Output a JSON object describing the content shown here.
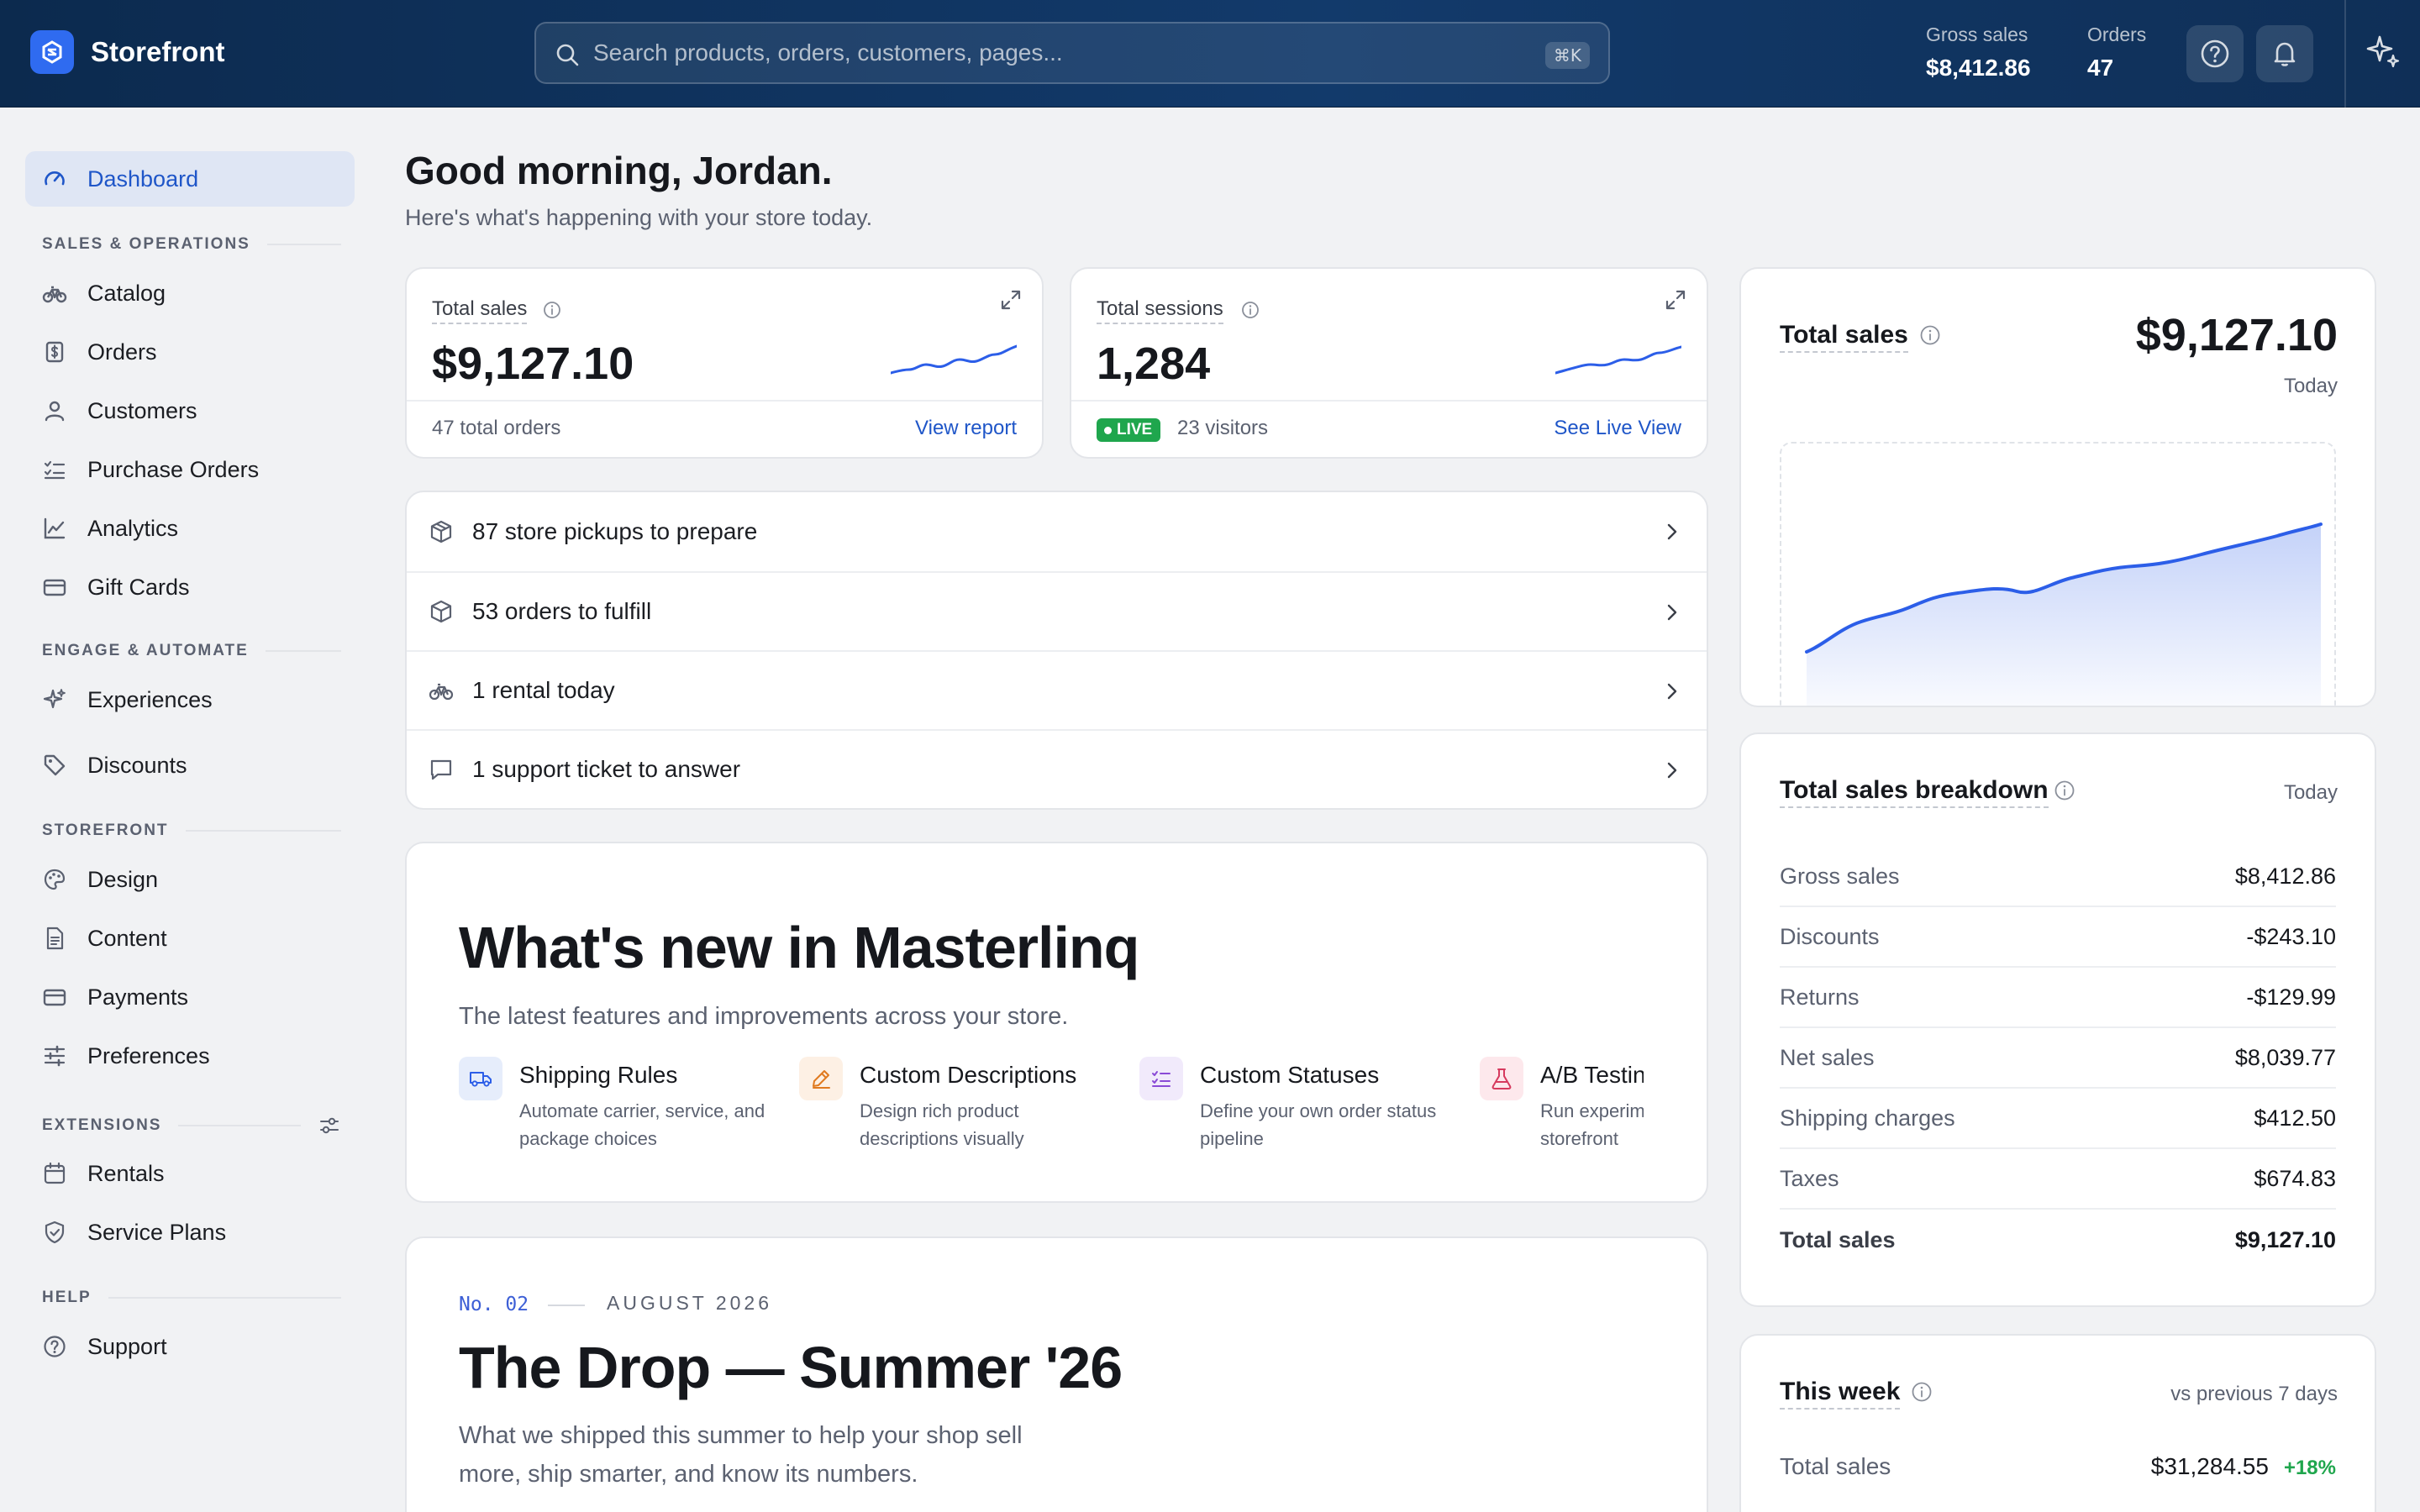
{
  "app": {
    "name": "Storefront"
  },
  "search": {
    "placeholder": "Search products, orders, customers, pages...",
    "shortcut": "⌘K"
  },
  "header_stats": [
    {
      "label": "Gross sales",
      "value": "$8,412.86"
    },
    {
      "label": "Orders",
      "value": "47"
    }
  ],
  "sidebar": {
    "dashboard": "Dashboard",
    "sections": [
      "SALES & OPERATIONS",
      "ENGAGE & AUTOMATE",
      "STOREFRONT",
      "EXTENSIONS",
      "HELP"
    ],
    "items": [
      "Catalog",
      "Orders",
      "Customers",
      "Purchase Orders",
      "Analytics",
      "Gift Cards",
      "Experiences",
      "Discounts",
      "Design",
      "Content",
      "Payments",
      "Preferences",
      "Rentals",
      "Service Plans",
      "Support"
    ]
  },
  "greeting": {
    "title": "Good morning, Jordan.",
    "subtitle": "Here's what's happening with your store today."
  },
  "kpi_sales": {
    "title": "Total sales",
    "value": "$9,127.10",
    "footer": "47 total orders",
    "link": "View report"
  },
  "kpi_sessions": {
    "title": "Total sessions",
    "value": "1,284",
    "badge": "LIVE",
    "footer": "23 visitors",
    "link": "See Live View"
  },
  "tasks": [
    "87 store pickups to prepare",
    "53 orders to fulfill",
    "1 rental today",
    "1 support ticket to answer"
  ],
  "whats_new": {
    "title": "What's new in Masterlinq",
    "subtitle": "The latest features and improvements across your store.",
    "features": [
      {
        "title": "Shipping Rules",
        "desc": "Automate carrier, service, and package choices"
      },
      {
        "title": "Custom Descriptions",
        "desc": "Design rich product descriptions visually"
      },
      {
        "title": "Custom Statuses",
        "desc": "Define your own order status pipeline"
      },
      {
        "title": "A/B Testing",
        "desc": "Run experiments on your storefront"
      }
    ]
  },
  "drop": {
    "number": "No. 02",
    "date": "AUGUST 2026",
    "title": "The Drop — Summer '26",
    "subtitle": "What we shipped this summer to help your shop sell more, ship smarter, and know its numbers."
  },
  "total_sales_panel": {
    "title": "Total sales",
    "value": "$9,127.10",
    "period": "Today"
  },
  "breakdown": {
    "title": "Total sales breakdown",
    "period": "Today",
    "rows": [
      {
        "label": "Gross sales",
        "value": "$8,412.86"
      },
      {
        "label": "Discounts",
        "value": "-$243.10"
      },
      {
        "label": "Returns",
        "value": "-$129.99"
      },
      {
        "label": "Net sales",
        "value": "$8,039.77"
      },
      {
        "label": "Shipping charges",
        "value": "$412.50"
      },
      {
        "label": "Taxes",
        "value": "$674.83"
      },
      {
        "label": "Total sales",
        "value": "$9,127.10"
      }
    ]
  },
  "this_week": {
    "title": "This week",
    "comparison": "vs previous 7 days",
    "row_label": "Total sales",
    "row_value": "$31,284.55",
    "change": "+18%"
  },
  "colors": {
    "accent": "#1f56c8",
    "topbar": "#0f2f57",
    "live": "#1fa64d",
    "positive": "#1fa64d"
  }
}
